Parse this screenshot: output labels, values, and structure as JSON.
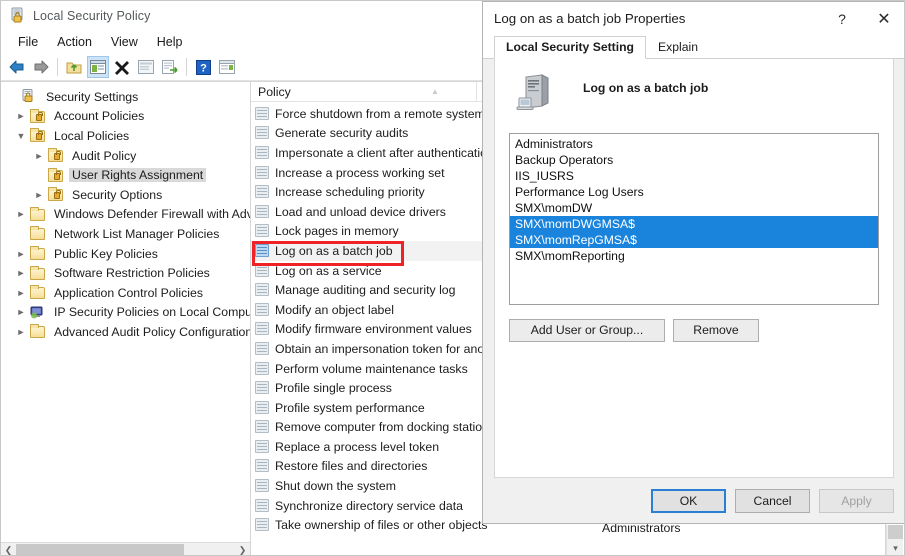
{
  "window": {
    "title": "Local Security Policy",
    "app_icon": "security-policy-icon"
  },
  "menubar": {
    "items": [
      "File",
      "Action",
      "View",
      "Help"
    ]
  },
  "toolbar": {
    "buttons": [
      {
        "name": "back-button",
        "icon": "arrow-left-icon"
      },
      {
        "name": "forward-button",
        "icon": "arrow-right-icon"
      },
      {
        "name": "up-one-level-button",
        "icon": "folder-up-icon"
      },
      {
        "name": "show-hide-console-tree-button",
        "icon": "console-tree-icon",
        "active": true
      },
      {
        "name": "delete-button",
        "icon": "x-delete-icon"
      },
      {
        "name": "properties-button",
        "icon": "properties-icon"
      },
      {
        "name": "export-list-button",
        "icon": "export-list-icon"
      },
      {
        "name": "help-button",
        "icon": "help-question-icon"
      },
      {
        "name": "show-hide-action-pane-button",
        "icon": "action-pane-icon"
      }
    ]
  },
  "tree": {
    "root": "Security Settings",
    "items": [
      {
        "label": "Security Settings",
        "indent": 0,
        "twisty": "",
        "icon": "security-settings-icon",
        "selected": false
      },
      {
        "label": "Account Policies",
        "indent": 1,
        "twisty": "collapsed",
        "icon": "folder-lock-icon",
        "selected": false
      },
      {
        "label": "Local Policies",
        "indent": 1,
        "twisty": "expanded",
        "icon": "folder-lock-icon",
        "selected": false
      },
      {
        "label": "Audit Policy",
        "indent": 2,
        "twisty": "collapsed",
        "icon": "folder-lock-icon",
        "selected": false
      },
      {
        "label": "User Rights Assignment",
        "indent": 2,
        "twisty": "",
        "icon": "folder-lock-icon",
        "selected": true
      },
      {
        "label": "Security Options",
        "indent": 2,
        "twisty": "collapsed",
        "icon": "folder-lock-icon",
        "selected": false
      },
      {
        "label": "Windows Defender Firewall with Advan",
        "indent": 1,
        "twisty": "collapsed",
        "icon": "folder-icon",
        "selected": false
      },
      {
        "label": "Network List Manager Policies",
        "indent": 1,
        "twisty": "",
        "icon": "folder-icon",
        "selected": false
      },
      {
        "label": "Public Key Policies",
        "indent": 1,
        "twisty": "collapsed",
        "icon": "folder-icon",
        "selected": false
      },
      {
        "label": "Software Restriction Policies",
        "indent": 1,
        "twisty": "collapsed",
        "icon": "folder-icon",
        "selected": false
      },
      {
        "label": "Application Control Policies",
        "indent": 1,
        "twisty": "collapsed",
        "icon": "folder-icon",
        "selected": false
      },
      {
        "label": "IP Security Policies on Local Computer",
        "indent": 1,
        "twisty": "collapsed",
        "icon": "ip-security-icon",
        "selected": false
      },
      {
        "label": "Advanced Audit Policy Configuration",
        "indent": 1,
        "twisty": "collapsed",
        "icon": "folder-icon",
        "selected": false
      }
    ]
  },
  "policy_list": {
    "column_header": "Policy",
    "second_column_value": "Administrators",
    "highlighted_policy": "Log on as a batch job",
    "rows": [
      {
        "label": "Force shutdown from a remote system",
        "highlighted": false
      },
      {
        "label": "Generate security audits",
        "highlighted": false
      },
      {
        "label": "Impersonate a client after authentication",
        "highlighted": false
      },
      {
        "label": "Increase a process working set",
        "highlighted": false
      },
      {
        "label": "Increase scheduling priority",
        "highlighted": false
      },
      {
        "label": "Load and unload device drivers",
        "highlighted": false
      },
      {
        "label": "Lock pages in memory",
        "highlighted": false
      },
      {
        "label": "Log on as a batch job",
        "highlighted": true
      },
      {
        "label": "Log on as a service",
        "highlighted": false
      },
      {
        "label": "Manage auditing and security log",
        "highlighted": false
      },
      {
        "label": "Modify an object label",
        "highlighted": false
      },
      {
        "label": "Modify firmware environment values",
        "highlighted": false
      },
      {
        "label": "Obtain an impersonation token for another user in the same session",
        "highlighted": false
      },
      {
        "label": "Perform volume maintenance tasks",
        "highlighted": false
      },
      {
        "label": "Profile single process",
        "highlighted": false
      },
      {
        "label": "Profile system performance",
        "highlighted": false
      },
      {
        "label": "Remove computer from docking station",
        "highlighted": false
      },
      {
        "label": "Replace a process level token",
        "highlighted": false
      },
      {
        "label": "Restore files and directories",
        "highlighted": false
      },
      {
        "label": "Shut down the system",
        "highlighted": false
      },
      {
        "label": "Synchronize directory service data",
        "highlighted": false
      },
      {
        "label": "Take ownership of files or other objects",
        "highlighted": false
      }
    ]
  },
  "dialog": {
    "title": "Log on as a batch job Properties",
    "help_glyph": "?",
    "close_glyph": "✕",
    "tabs": [
      {
        "label": "Local Security Setting",
        "active": true
      },
      {
        "label": "Explain",
        "active": false
      }
    ],
    "policy_name": "Log on as a batch job",
    "policy_icon": "server-computer-icon",
    "members": [
      {
        "name": "Administrators",
        "selected": false
      },
      {
        "name": "Backup Operators",
        "selected": false
      },
      {
        "name": "IIS_IUSRS",
        "selected": false
      },
      {
        "name": "Performance Log Users",
        "selected": false
      },
      {
        "name": "SMX\\momDW",
        "selected": false
      },
      {
        "name": "SMX\\momDWGMSA$",
        "selected": true
      },
      {
        "name": "SMX\\momRepGMSA$",
        "selected": true
      },
      {
        "name": "SMX\\momReporting",
        "selected": false
      }
    ],
    "actions": {
      "add": "Add User or Group...",
      "remove": "Remove"
    },
    "footer": {
      "ok": "OK",
      "cancel": "Cancel",
      "apply": "Apply"
    }
  },
  "colors": {
    "selection_blue": "#1a84dc",
    "highlight_red": "#ef2225",
    "tree_selected_grey": "#d9d9d9",
    "accent_focus": "#2a7fd4"
  }
}
